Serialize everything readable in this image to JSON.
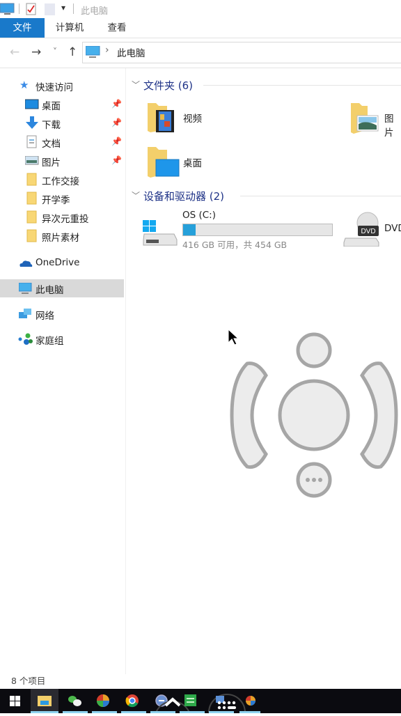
{
  "window": {
    "title": "此电脑",
    "quick_access_toolbar": [
      "computer-icon",
      "properties-icon",
      "new-folder-icon",
      "customize-dropdown-icon"
    ]
  },
  "ribbon": {
    "tabs": [
      {
        "label": "文件",
        "active": true
      },
      {
        "label": "计算机",
        "active": false
      },
      {
        "label": "查看",
        "active": false
      }
    ]
  },
  "navigation": {
    "back_icon": "←",
    "forward_icon": "→",
    "recent_icon": "˅",
    "up_icon": "↑",
    "breadcrumb_separator": "›",
    "path": "此电脑"
  },
  "sidebar": {
    "quick_access": {
      "label": "快速访问"
    },
    "pinned": [
      {
        "label": "桌面",
        "icon": "desktop-icon",
        "pinned": true
      },
      {
        "label": "下载",
        "icon": "download-icon",
        "pinned": true
      },
      {
        "label": "文档",
        "icon": "documents-icon",
        "pinned": true
      },
      {
        "label": "图片",
        "icon": "pictures-icon",
        "pinned": true
      }
    ],
    "folders": [
      {
        "label": "工作交接"
      },
      {
        "label": "开学季"
      },
      {
        "label": "异次元重投"
      },
      {
        "label": "照片素材"
      }
    ],
    "onedrive": {
      "label": "OneDrive"
    },
    "this_pc": {
      "label": "此电脑",
      "selected": true
    },
    "network": {
      "label": "网络"
    },
    "homegroup": {
      "label": "家庭组"
    }
  },
  "main": {
    "folders_group": {
      "title": "文件夹 (6)",
      "items": [
        {
          "label": "视频",
          "icon": "videos-folder-icon"
        },
        {
          "label": "图片",
          "icon": "pictures-folder-icon"
        },
        {
          "label": "桌面",
          "icon": "desktop-folder-icon"
        }
      ]
    },
    "devices_group": {
      "title": "设备和驱动器 (2)",
      "drives": [
        {
          "label": "OS (C:)",
          "free": "416 GB 可用，共 454 GB",
          "used_fraction": 0.084,
          "bar_color": "#26a0da"
        },
        {
          "label": "DVD",
          "icon": "dvd-drive-icon"
        }
      ]
    }
  },
  "status_bar": {
    "item_count": "8 个项目"
  },
  "overlay": {
    "type": "virtual-gamepad-control",
    "more_icon": "•••"
  },
  "taskbar": {
    "icons": [
      "start-icon",
      "file-explorer-icon",
      "wechat-icon",
      "browser-icon",
      "chrome-icon",
      "app-icon",
      "expand-up-icon",
      "green-app-icon",
      "keyboard-icon",
      "colorful-app-icon"
    ]
  },
  "colors": {
    "accent": "#1979ca",
    "header_text": "#1e3287",
    "selected_bg": "#d9d9d9"
  }
}
